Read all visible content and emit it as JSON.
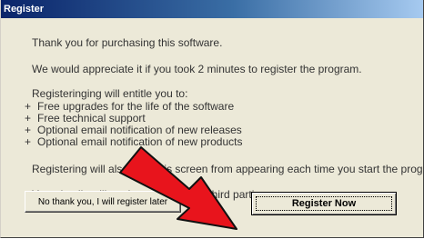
{
  "window": {
    "title": "Register"
  },
  "message": {
    "thanks": "Thank you for purchasing this software.",
    "appreciate": "We would appreciate it if you took 2 minutes to register the program.",
    "entitle_intro": "Registeringing will entitle you to:",
    "benefits": [
      "Free upgrades for the life of the software",
      "Free technical support",
      "Optional email notification of new releases",
      "Optional email notification of new products"
    ],
    "benefit_bullet": "+",
    "stop_screen": "Registering will also stop this screen from appearing each time you start the program.",
    "privacy": "Your details will not be passed on to third parties."
  },
  "buttons": {
    "later": "No thank you, I will register later",
    "register": "Register Now"
  },
  "colors": {
    "dialog_background": "#ece9d8",
    "arrow": "#e8141c",
    "title_gradient_start": "#0a246a",
    "title_gradient_end": "#a6caf0"
  },
  "annotation": {
    "type": "red-arrow",
    "points_to": "register-now-button"
  }
}
